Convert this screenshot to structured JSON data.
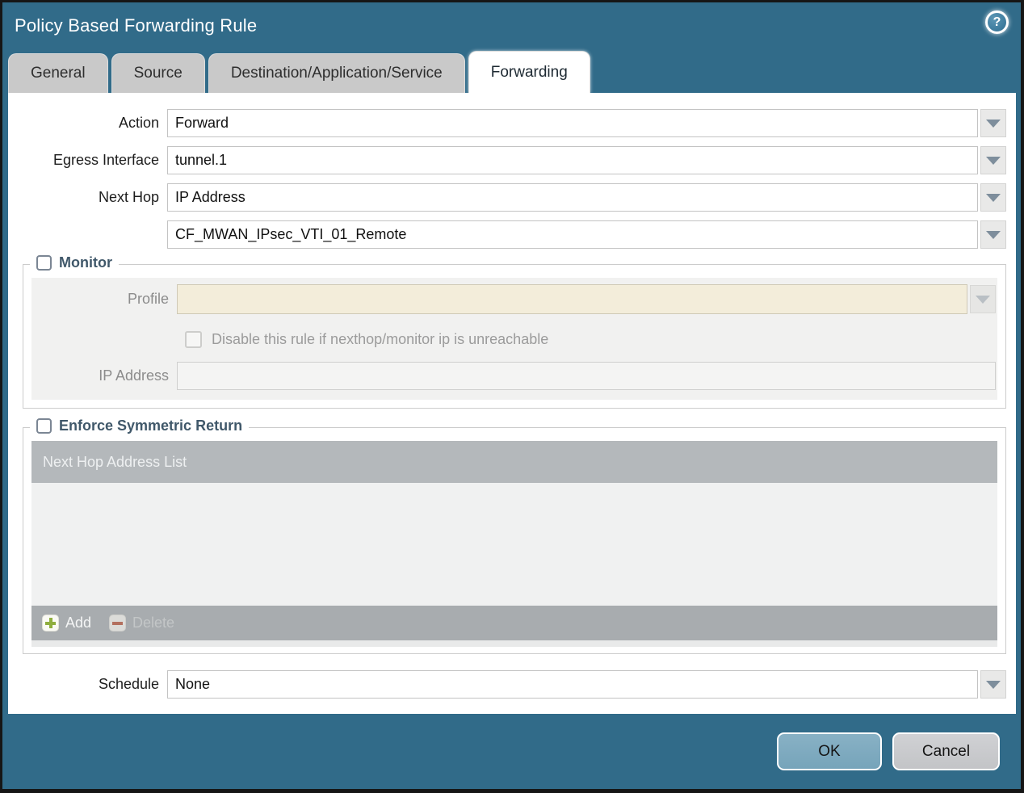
{
  "dialog": {
    "title": "Policy Based Forwarding Rule",
    "help_icon": "?"
  },
  "tabs": [
    {
      "label": "General",
      "active": false
    },
    {
      "label": "Source",
      "active": false
    },
    {
      "label": "Destination/Application/Service",
      "active": false
    },
    {
      "label": "Forwarding",
      "active": true
    }
  ],
  "form": {
    "action": {
      "label": "Action",
      "value": "Forward"
    },
    "egress_interface": {
      "label": "Egress Interface",
      "value": "tunnel.1"
    },
    "next_hop": {
      "label": "Next Hop",
      "value": "IP Address"
    },
    "next_hop_address": {
      "value": "CF_MWAN_IPsec_VTI_01_Remote"
    },
    "schedule": {
      "label": "Schedule",
      "value": "None"
    }
  },
  "monitor": {
    "legend": "Monitor",
    "checked": false,
    "profile": {
      "label": "Profile",
      "value": ""
    },
    "disable_rule_checkbox": {
      "label": "Disable this rule if nexthop/monitor ip is unreachable",
      "checked": false,
      "disabled": true
    },
    "ip_address": {
      "label": "IP Address",
      "value": ""
    }
  },
  "symmetric_return": {
    "legend": "Enforce Symmetric Return",
    "checked": false,
    "list_header": "Next Hop Address List",
    "rows": [],
    "add_label": "Add",
    "delete_label": "Delete",
    "delete_disabled": true
  },
  "footer": {
    "ok_label": "OK",
    "cancel_label": "Cancel"
  },
  "colors": {
    "titlebar_teal": "#316b89",
    "active_tab": "#ffffff",
    "inactive_tab": "#c9c9c9",
    "legend_text": "#40586a",
    "disabled_field_cream": "#f3edda",
    "panel_grey": "#f1f1f0",
    "table_header_grey": "#b4b8bb",
    "table_footer_grey": "#a8acaf",
    "ok_button_blue": "#7fabc0",
    "cancel_button_grey": "#c9cacd",
    "add_plus_green": "#8fae3e",
    "delete_minus_red": "#b3705f"
  }
}
